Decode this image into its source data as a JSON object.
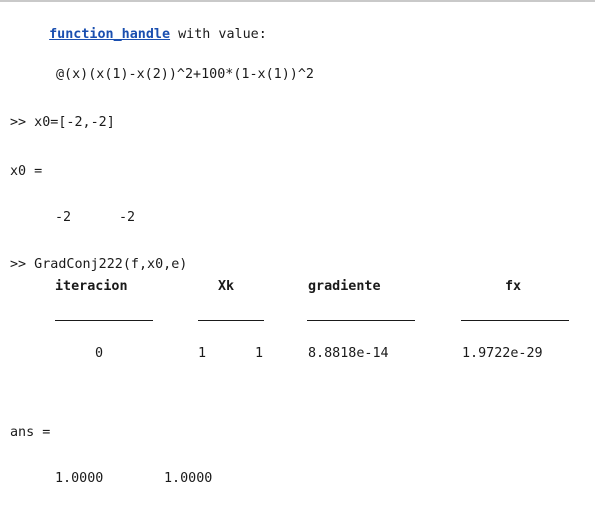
{
  "header": {
    "link_text": "function_handle",
    "suffix_text": " with value:"
  },
  "function_value": "@(x)(x(1)-x(2))^2+100*(1-x(1))^2",
  "commands": {
    "cmd1": ">> x0=[-2,-2]",
    "cmd2": ">> GradConj222(f,x0,e)"
  },
  "x0_output": {
    "label": "x0 =",
    "values": [
      "-2",
      "-2"
    ]
  },
  "table": {
    "headers": [
      "iteracion",
      "Xk",
      "gradiente",
      "fx"
    ],
    "underlines": [
      "_________",
      "______",
      "__________",
      "__________"
    ],
    "rows": [
      {
        "iteracion": "0",
        "xk1": "1",
        "xk2": "1",
        "gradiente": "8.8818e-14",
        "fx": "1.9722e-29"
      }
    ]
  },
  "ans_output": {
    "label": "ans =",
    "values": [
      "1.0000",
      "1.0000"
    ]
  }
}
